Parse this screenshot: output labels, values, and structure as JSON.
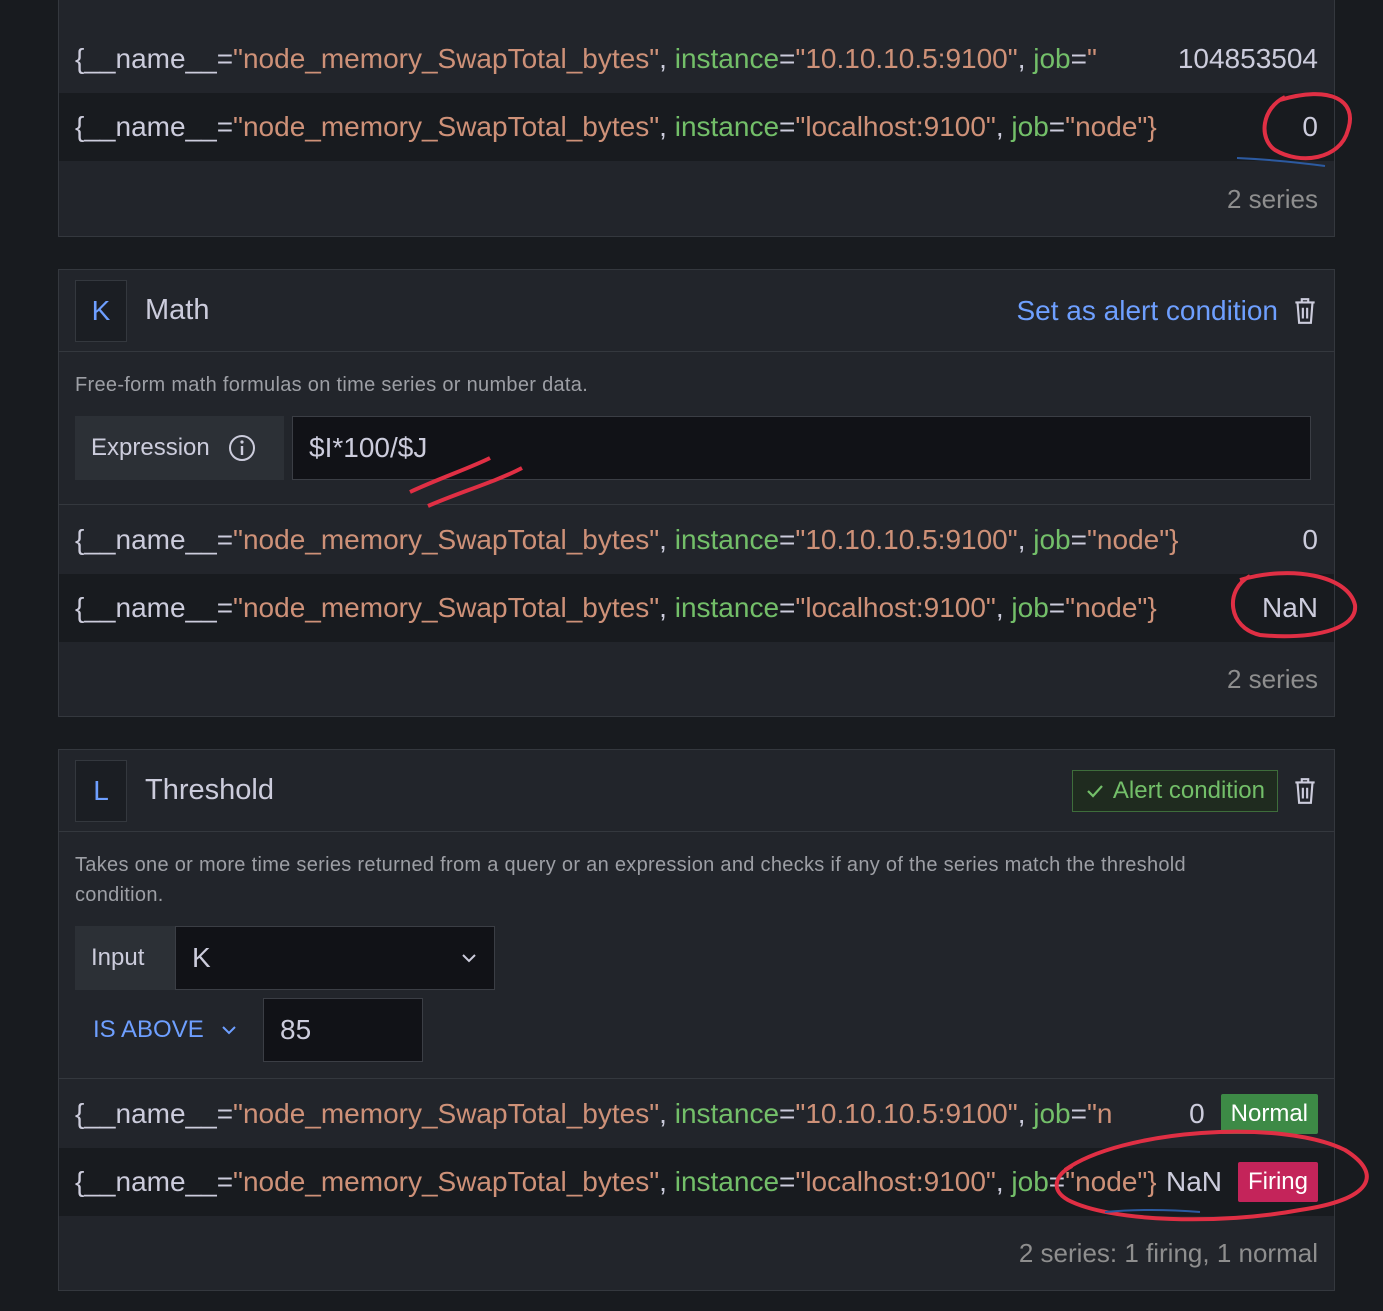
{
  "series_label": {
    "name_key": "{__name__",
    "eq": "=",
    "name_value": "\"node_memory_SwapTotal_bytes\"",
    "comma": ",",
    "instance_key": "instance",
    "job_key": "job",
    "instance_a": "\"10.10.10.5:9100\"",
    "instance_b": "\"localhost:9100\"",
    "job_node": "\"node\"}",
    "job_trunc_a": "\"",
    "job_trunc_b": "\"n",
    "job_trunc_c": "\"node\"}"
  },
  "top_card": {
    "rows": [
      {
        "value": "104853504"
      },
      {
        "value": "0"
      }
    ],
    "footer": "2 series"
  },
  "math_card": {
    "ref": "K",
    "title": "Math",
    "set_alert_link": "Set as alert condition",
    "description": "Free-form math formulas on time series or number data.",
    "expression_label": "Expression",
    "expression_value": "$I*100/$J",
    "rows": [
      {
        "value": "0"
      },
      {
        "value": "NaN"
      }
    ],
    "footer": "2 series"
  },
  "threshold_card": {
    "ref": "L",
    "title": "Threshold",
    "alert_condition_label": "Alert condition",
    "description": "Takes one or more time series returned from a query or an expression and checks if any of the series match the threshold condition.",
    "input_label": "Input",
    "input_value": "K",
    "operator": "IS ABOVE",
    "threshold_value": "85",
    "rows": [
      {
        "value": "0",
        "status": "Normal"
      },
      {
        "value": "NaN",
        "status": "Firing"
      }
    ],
    "footer": "2 series: 1 firing, 1 normal"
  },
  "colors": {
    "label_key": "#73bf69",
    "label_value": "#ce9178",
    "link": "#6e9fff",
    "normal": "#3d8a46",
    "firing": "#c4245a",
    "annotation": "#e02f44"
  }
}
